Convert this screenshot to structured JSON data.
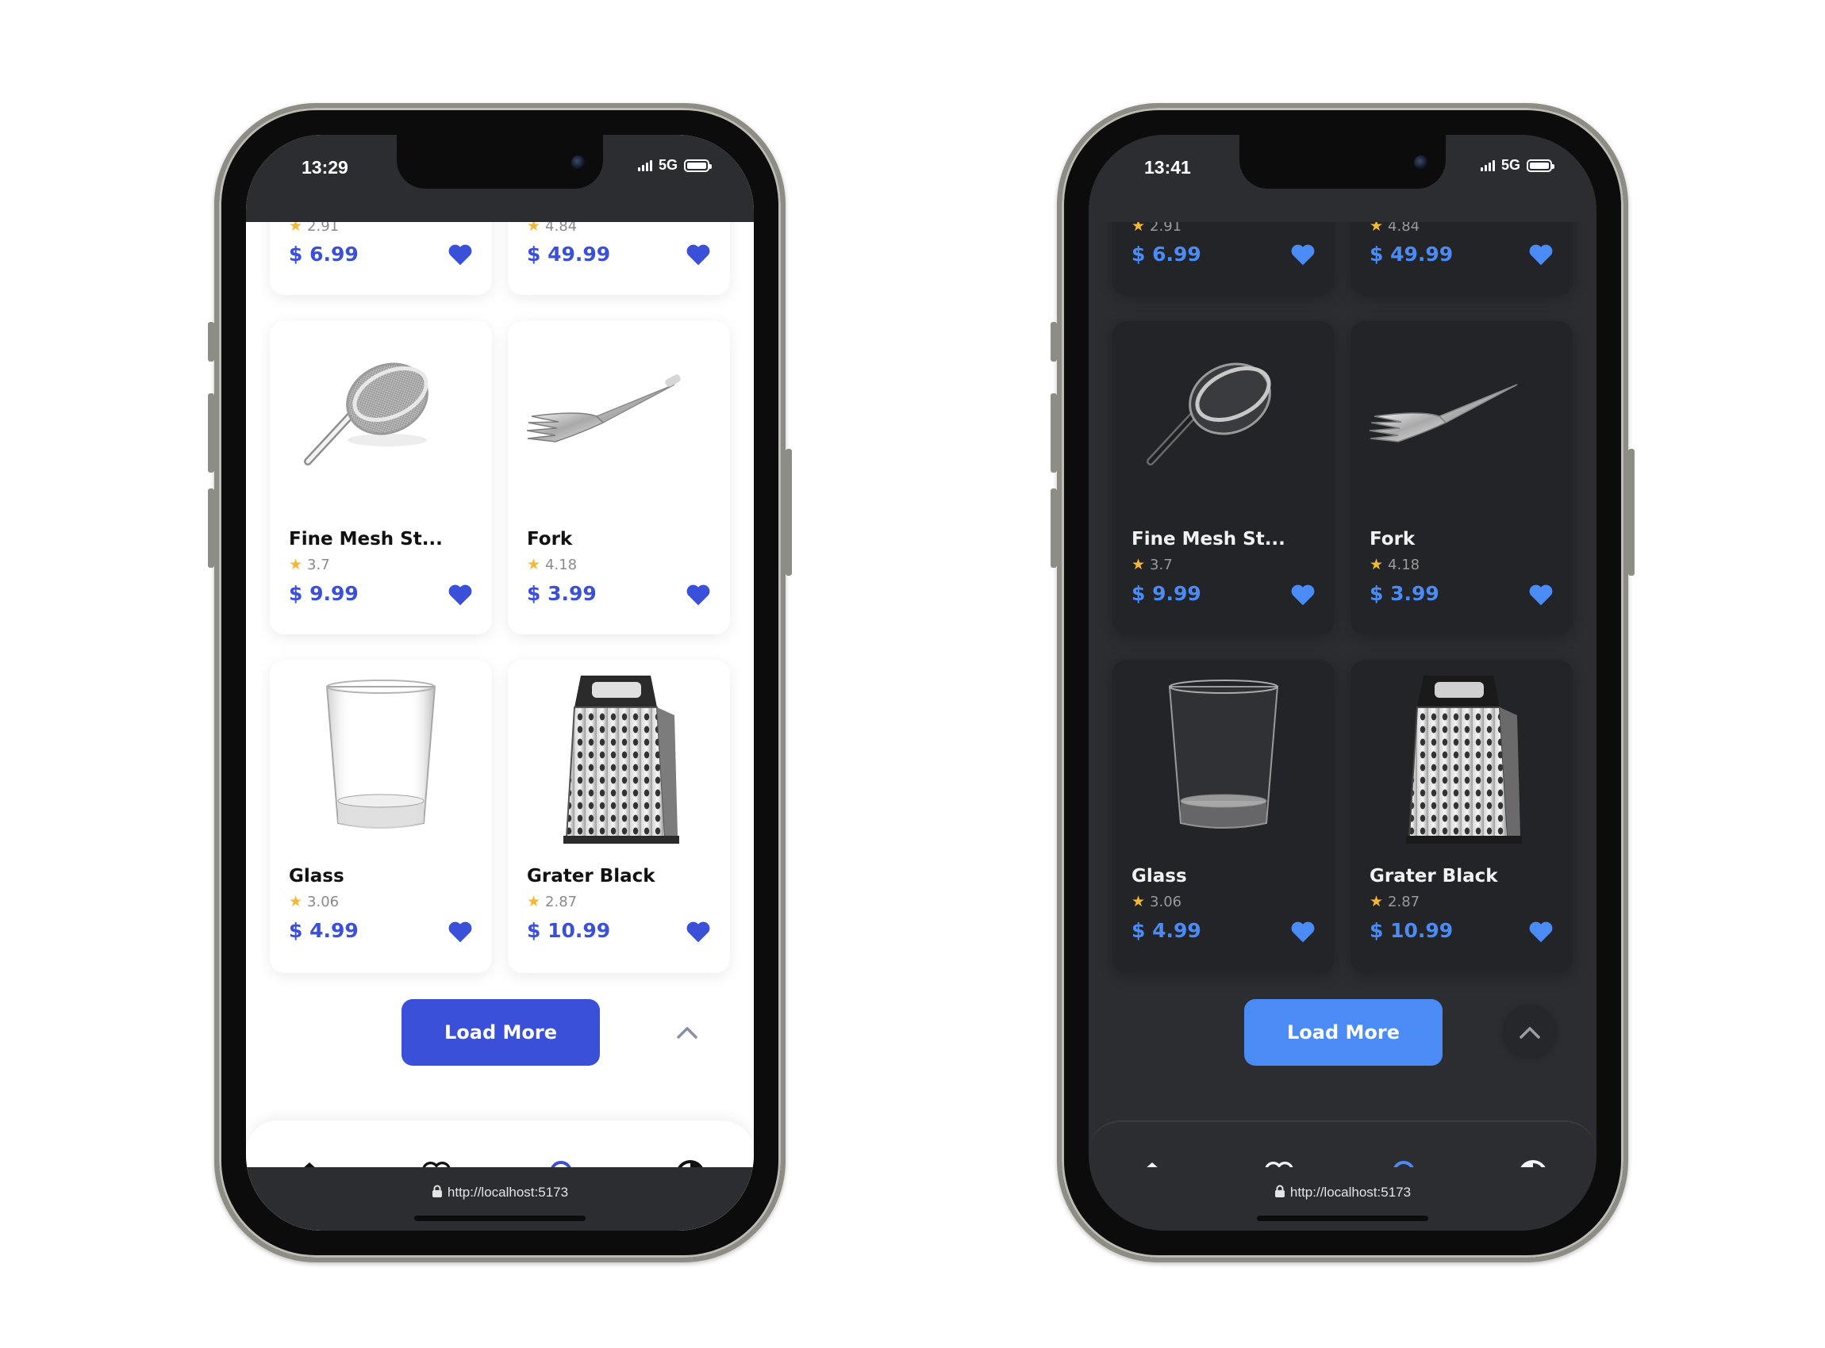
{
  "screens": [
    {
      "theme": "light",
      "status": {
        "time": "13:29",
        "network": "5G"
      },
      "products": [
        {
          "name": "",
          "rating": "2.91",
          "price": "$ 6.99"
        },
        {
          "name": "",
          "rating": "4.84",
          "price": "$ 49.99"
        },
        {
          "name": "Fine Mesh St...",
          "rating": "3.7",
          "price": "$ 9.99",
          "image": "strainer"
        },
        {
          "name": "Fork",
          "rating": "4.18",
          "price": "$ 3.99",
          "image": "fork"
        },
        {
          "name": "Glass",
          "rating": "3.06",
          "price": "$ 4.99",
          "image": "glass"
        },
        {
          "name": "Grater Black",
          "rating": "2.87",
          "price": "$ 10.99",
          "image": "grater"
        }
      ],
      "load_more_label": "Load More",
      "nav": [
        "home-icon",
        "heart-outline-icon",
        "search-icon",
        "contrast-icon"
      ],
      "active_nav": "search-icon",
      "url": "http://localhost:5173"
    },
    {
      "theme": "dark",
      "status": {
        "time": "13:41",
        "network": "5G"
      },
      "products": [
        {
          "name": "",
          "rating": "2.91",
          "price": "$ 6.99"
        },
        {
          "name": "",
          "rating": "4.84",
          "price": "$ 49.99"
        },
        {
          "name": "Fine Mesh St...",
          "rating": "3.7",
          "price": "$ 9.99",
          "image": "strainer"
        },
        {
          "name": "Fork",
          "rating": "4.18",
          "price": "$ 3.99",
          "image": "fork"
        },
        {
          "name": "Glass",
          "rating": "3.06",
          "price": "$ 4.99",
          "image": "glass"
        },
        {
          "name": "Grater Black",
          "rating": "2.87",
          "price": "$ 10.99",
          "image": "grater"
        }
      ],
      "load_more_label": "Load More",
      "nav": [
        "home-icon",
        "heart-outline-icon",
        "search-icon",
        "contrast-icon"
      ],
      "active_nav": "search-icon",
      "url": "http://localhost:5173"
    }
  ],
  "colors": {
    "light_accent": "#3a50d8",
    "dark_accent": "#4a8bf6",
    "star": "#f5b833",
    "dark_bg": "#2b2d31"
  }
}
